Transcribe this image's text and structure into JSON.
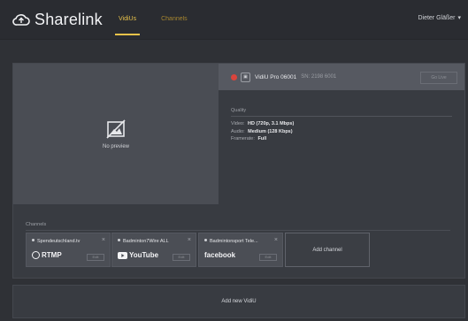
{
  "app": {
    "name": "Sharelink"
  },
  "nav": {
    "tabs": [
      {
        "label": "VidiUs",
        "active": true
      },
      {
        "label": "Channels",
        "active": false
      }
    ],
    "user": "Dieter Gläßer"
  },
  "preview": {
    "label": "No preview"
  },
  "device": {
    "name": "VidiU Pro 06001",
    "serial": "SN: 2198 6001",
    "action_label": "Go Live",
    "status_color": "#d9443c"
  },
  "quality": {
    "title": "Quality",
    "rows": [
      {
        "label": "Video:",
        "value": "HD (720p, 3.1 Mbps)"
      },
      {
        "label": "Audio:",
        "value": "Medium (128 Kbps)"
      },
      {
        "label": "Framerate:",
        "value": "Full"
      }
    ]
  },
  "channels": {
    "title": "Channels",
    "items": [
      {
        "title": "Spendeutschland.tv",
        "logo": "RTMP",
        "logo_icon": "rtmp-icon",
        "action": "Edit"
      },
      {
        "title": "Badminton7Wire ALL",
        "logo": "YouTube",
        "logo_icon": "youtube-icon",
        "action": "Edit"
      },
      {
        "title": "Badmintonsport Tele...",
        "logo": "facebook",
        "logo_icon": "facebook-icon",
        "action": "Edit"
      }
    ],
    "add_label": "Add channel"
  },
  "footer": {
    "add_vidiu_label": "Add new VidiU"
  },
  "colors": {
    "accent": "#e8c24a",
    "background": "#2f3136",
    "card": "#383b41"
  }
}
